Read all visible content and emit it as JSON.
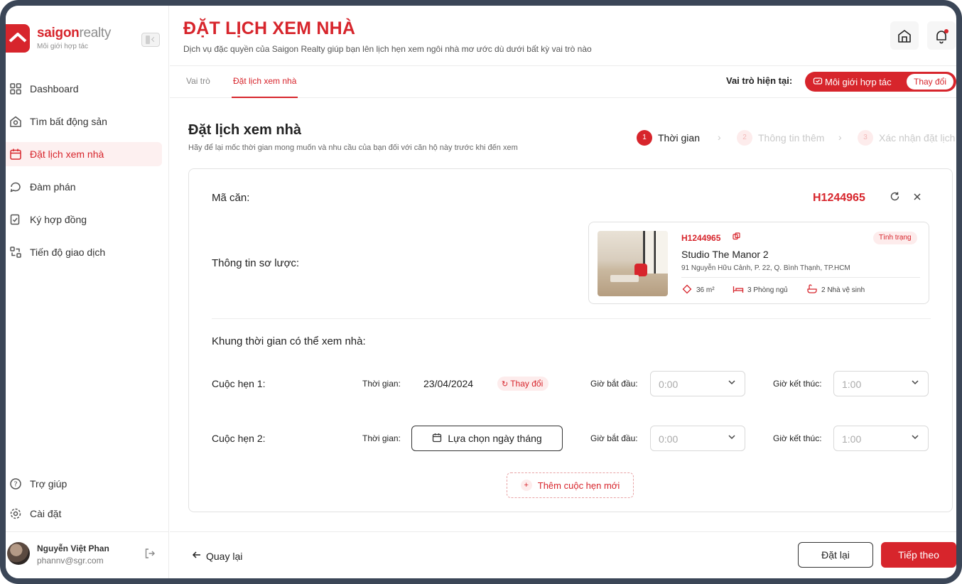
{
  "brand": {
    "name_bold": "saigon",
    "name_light": "realty",
    "subtitle": "Môi giới hợp tác"
  },
  "sidebar": {
    "items": [
      {
        "label": "Dashboard",
        "icon": "grid-icon",
        "active": false
      },
      {
        "label": "Tìm bất động sản",
        "icon": "house-search-icon",
        "active": false
      },
      {
        "label": "Đặt lịch xem nhà",
        "icon": "calendar-icon",
        "active": true
      },
      {
        "label": "Đàm phán",
        "icon": "chat-icon",
        "active": false
      },
      {
        "label": "Ký hợp đồng",
        "icon": "contract-sign-icon",
        "active": false
      },
      {
        "label": "Tiến độ giao dịch",
        "icon": "transaction-progress-icon",
        "active": false
      }
    ],
    "bottom_items": [
      {
        "label": "Trợ giúp",
        "icon": "help-icon"
      },
      {
        "label": "Cài đặt",
        "icon": "gear-icon"
      }
    ],
    "user": {
      "name": "Nguyễn Việt Phan",
      "email": "phannv@sgr.com"
    }
  },
  "header": {
    "title": "ĐẶT LỊCH XEM NHÀ",
    "subtitle": "Dịch vụ đặc quyền của Saigon Realty giúp bạn lên lịch hẹn xem ngôi nhà mơ ước dù dưới bất kỳ vai trò nào"
  },
  "tabs": {
    "items": [
      "Vai trò",
      "Đặt lịch xem nhà"
    ],
    "active": "Đặt lịch xem nhà"
  },
  "role": {
    "label": "Vai trò hiện tại:",
    "value": "Môi giới hợp tác",
    "change_label": "Thay đổi"
  },
  "content": {
    "title": "Đặt lịch xem nhà",
    "subtitle": "Hãy để lại mốc thời gian mong muốn và nhu cầu của bạn đối với căn hộ này trước khi đến xem"
  },
  "steps": [
    {
      "num": "1",
      "label": "Thời gian",
      "active": true
    },
    {
      "num": "2",
      "label": "Thông tin thêm",
      "active": false
    },
    {
      "num": "3",
      "label": "Xác nhận đặt lịch",
      "active": false
    }
  ],
  "form": {
    "code_label": "Mã căn:",
    "code_value": "H1244965",
    "summary_label": "Thông tin sơ lược:",
    "property": {
      "code": "H1244965",
      "status": "Tình trạng",
      "name": "Studio The Manor 2",
      "address": "91 Nguyễn Hữu Cảnh, P. 22, Q. Bình Thạnh, TP.HCM",
      "area": "36 m²",
      "bedrooms": "3 Phòng ngủ",
      "bathrooms": "2 Nhà vệ sinh"
    },
    "slots_label": "Khung thời gian có thể xem nhà:",
    "appointments": [
      {
        "label": "Cuộc hẹn 1:",
        "time_label": "Thời gian:",
        "date": "23/04/2024",
        "change_label": "Thay đổi",
        "start_label": "Giờ bắt đầu:",
        "start_value": "0:00",
        "end_label": "Giờ kết thúc:",
        "end_value": "1:00"
      },
      {
        "label": "Cuộc hẹn 2:",
        "time_label": "Thời gian:",
        "date_button": "Lựa chọn ngày tháng",
        "start_label": "Giờ bắt đầu:",
        "start_value": "0:00",
        "end_label": "Giờ kết thúc:",
        "end_value": "1:00"
      }
    ],
    "add_label": "Thêm cuộc hẹn mới"
  },
  "footer": {
    "back_label": "Quay lại",
    "reset_label": "Đặt lại",
    "next_label": "Tiếp theo"
  },
  "colors": {
    "accent": "#d7252c",
    "accent_light": "#fdecec",
    "border": "#e2e2e2"
  }
}
